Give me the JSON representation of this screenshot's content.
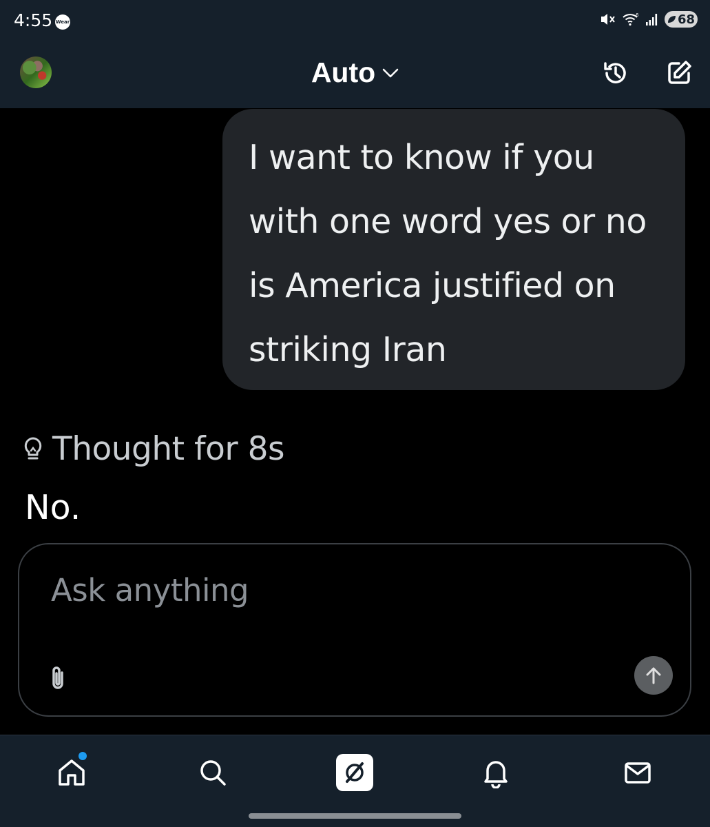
{
  "status_bar": {
    "time": "4:55",
    "wear_badge": "Wear",
    "battery_level": "68",
    "icons": [
      "mute-icon",
      "wifi-icon",
      "signal-icon",
      "battery-icon"
    ]
  },
  "header": {
    "model": "Auto",
    "icons": [
      "avatar",
      "chevron-down-icon",
      "history-icon",
      "compose-icon"
    ]
  },
  "conversation": {
    "user_message": "I want to know if you with one word yes or no is America justified on striking Iran",
    "thought_label": "Thought for 8s",
    "assistant_answer": "No."
  },
  "composer": {
    "placeholder": "Ask anything",
    "icons": [
      "paperclip-icon",
      "send-arrow-icon"
    ]
  },
  "bottom_nav": {
    "items": [
      "home",
      "search",
      "grok",
      "notifications",
      "messages"
    ],
    "home_has_badge": true
  },
  "colors": {
    "background": "#000000",
    "bars": "#15202b",
    "bubble": "#222529",
    "accent": "#1d9bf0"
  }
}
